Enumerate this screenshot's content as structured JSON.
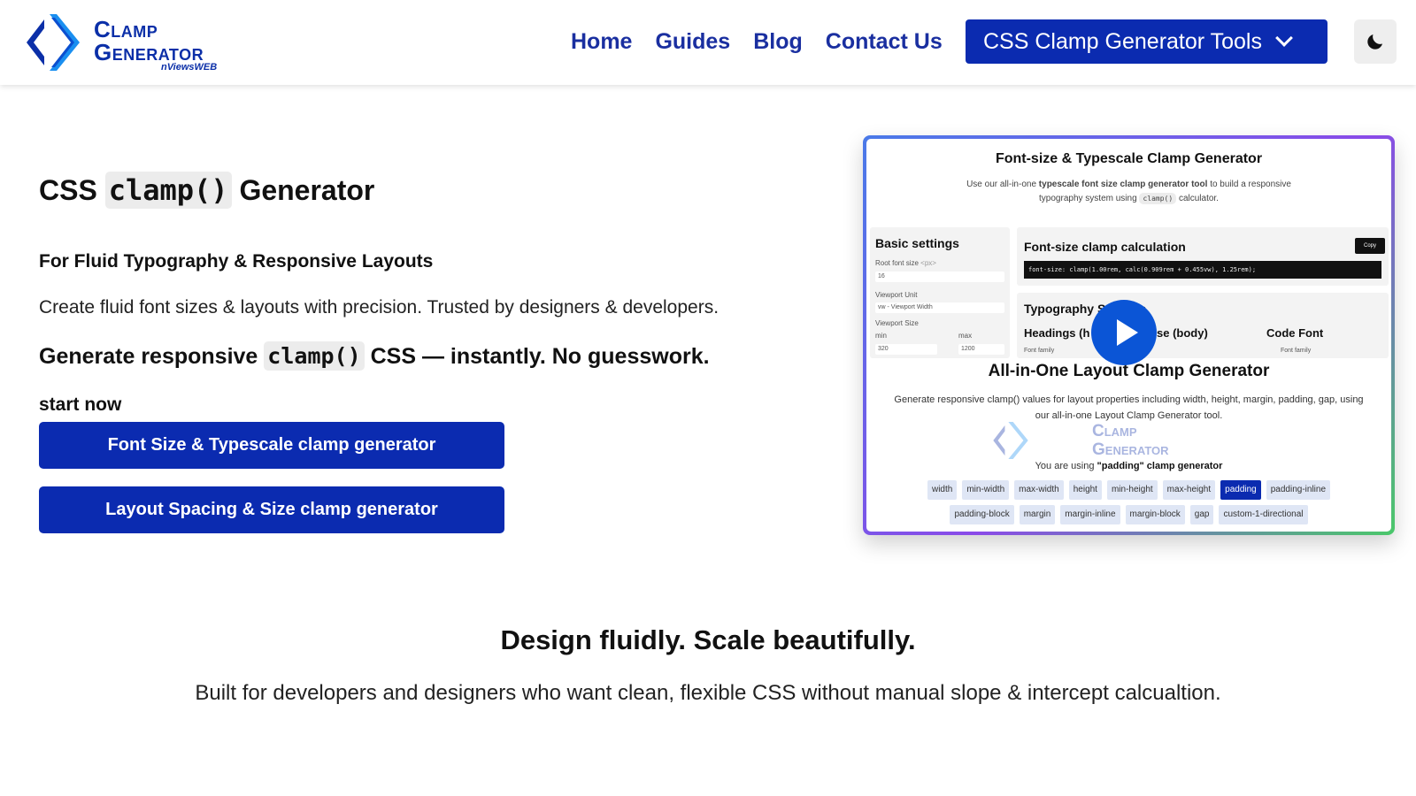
{
  "brand": {
    "logo_line1": "Clamp",
    "logo_line2": "Generator",
    "logo_sub": "nViewsWEB",
    "color": "#0b2fa8"
  },
  "nav": {
    "items": [
      {
        "label": "Home"
      },
      {
        "label": "Guides"
      },
      {
        "label": "Blog"
      },
      {
        "label": "Contact Us"
      }
    ],
    "tools_button": "CSS Clamp Generator Tools",
    "theme_icon": "moon-icon"
  },
  "hero": {
    "title_pre": "CSS",
    "title_code": "clamp()",
    "title_post": "Generator",
    "subtitle": "For Fluid Typography & Responsive Layouts",
    "description": "Create fluid font sizes & layouts with precision. Trusted by designers & developers.",
    "gen_pre": "Generate responsive",
    "gen_code": "clamp()",
    "gen_post": "CSS — instantly. No guesswork.",
    "start_label": "start now",
    "cta_primary": "Font Size & Typescale clamp generator",
    "cta_secondary": "Layout Spacing & Size clamp generator"
  },
  "preview": {
    "title": "Font-size & Typescale Clamp Generator",
    "desc_pre": "Use our all-in-one",
    "desc_bold": "typescale font size clamp generator tool",
    "desc_post": "to build a responsive typography system using",
    "desc_code": "clamp()",
    "desc_end": "calculator.",
    "basic_title": "Basic settings",
    "root_label": "Root font size",
    "root_unit": "<px>",
    "root_value": "16",
    "viewport_unit_label": "Viewport Unit",
    "viewport_unit_value": "vw - Viewport Width",
    "viewport_size_label": "Viewport Size",
    "min_label": "min",
    "max_label": "max",
    "min_value": "320",
    "max_value": "1200",
    "calc_title": "Font-size clamp calculation",
    "copy_label": "Copy",
    "calc_code": "font-size: clamp(1.00rem, calc(0.909rem + 0.455vw), 1.25rem);",
    "typo_title": "Typography Settings",
    "typo_h1": "Headings (h",
    "typo_h2": "se (body)",
    "typo_h3": "Code Font",
    "font_family_label": "Font family",
    "layout_title": "All-in-One Layout Clamp Generator",
    "layout_desc": "Generate responsive clamp() values for layout properties including width, height, margin, padding, gap, using our all-in-one Layout Clamp Generator tool.",
    "ghost_logo_1": "Clamp",
    "ghost_logo_2": "Generator",
    "using_pre": "You are using",
    "using_bold": "\"padding\" clamp generator",
    "chips": [
      "width",
      "min-width",
      "max-width",
      "height",
      "min-height",
      "max-height",
      "padding",
      "padding-inline",
      "padding-block",
      "margin",
      "margin-inline",
      "margin-block",
      "gap",
      "custom-1-directional"
    ],
    "active_chip": "padding"
  },
  "tagline": {
    "title": "Design fluidly. Scale beautifully.",
    "description": "Built for developers and designers who want clean, flexible CSS without manual slope & intercept calcualtion."
  }
}
